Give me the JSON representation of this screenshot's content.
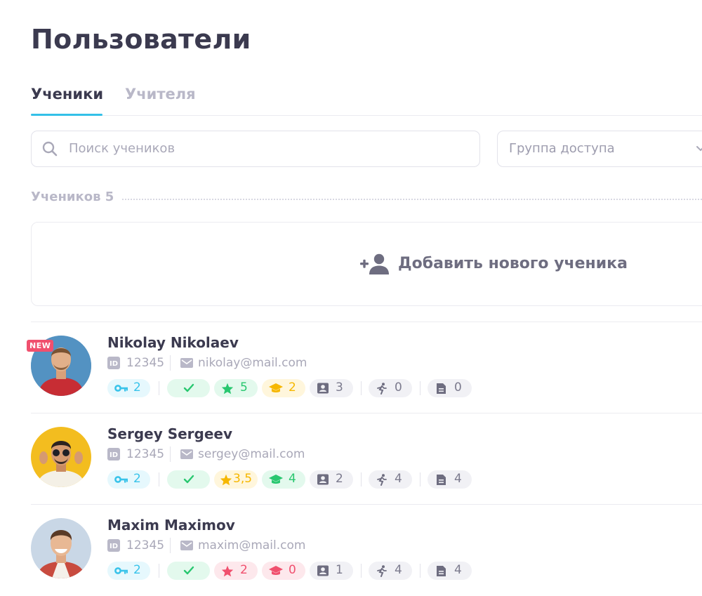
{
  "page_title": "Пользователи",
  "tabs": [
    {
      "label": "Ученики",
      "active": true
    },
    {
      "label": "Учителя",
      "active": false
    }
  ],
  "search": {
    "placeholder": "Поиск учеников",
    "value": ""
  },
  "access_group": {
    "placeholder": "Группа доступа"
  },
  "students_count_label": "Учеников 5",
  "add_student": {
    "label": "Добавить нового ученика"
  },
  "colors": {
    "accent": "#34c0e8",
    "new_badge": "#f0506e",
    "key_bg": "#e6f8fd",
    "key_fg": "#39c3ea",
    "check_bg": "#e3f9ed",
    "check_fg": "#28c76f",
    "star_green_bg": "#e3f9ed",
    "star_green_fg": "#28c76f",
    "star_yellow_bg": "#fff6dc",
    "star_yellow_fg": "#f6b700",
    "star_red_bg": "#fde8ec",
    "star_red_fg": "#f0506e",
    "neutral_bg": "#f1f1f5",
    "neutral_fg": "#7c7b8e"
  },
  "users": [
    {
      "name": "Nikolay Nikolaev",
      "is_new": true,
      "new_label": "NEW",
      "id": "12345",
      "email": "nikolay@mail.com",
      "stats": {
        "keys": "2",
        "stars": "5",
        "stars_color": "green",
        "courses": "2",
        "courses_color": "yellow",
        "profiles": "3",
        "activity": "0",
        "docs": "0"
      }
    },
    {
      "name": "Sergey Sergeev",
      "is_new": false,
      "id": "12345",
      "email": "sergey@mail.com",
      "stats": {
        "keys": "2",
        "stars": "3,5",
        "stars_color": "yellow",
        "courses": "4",
        "courses_color": "green",
        "profiles": "2",
        "activity": "4",
        "docs": "4"
      }
    },
    {
      "name": "Maxim Maximov",
      "is_new": false,
      "id": "12345",
      "email": "maxim@mail.com",
      "stats": {
        "keys": "2",
        "stars": "2",
        "stars_color": "red",
        "courses": "0",
        "courses_color": "red",
        "profiles": "1",
        "activity": "4",
        "docs": "4"
      }
    }
  ]
}
